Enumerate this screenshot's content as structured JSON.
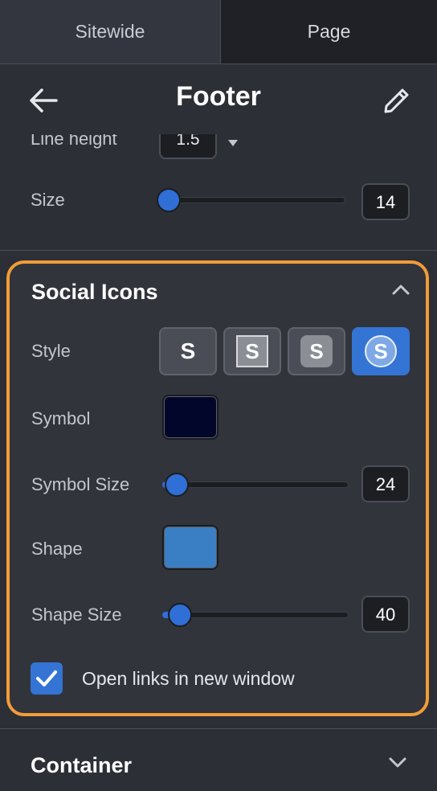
{
  "tabs": [
    {
      "label": "Sitewide"
    },
    {
      "label": "Page"
    }
  ],
  "header": {
    "title": "Footer"
  },
  "typography": {
    "line_height_label": "Line height",
    "line_height_value": "1.5",
    "size_label": "Size",
    "size_value": "14"
  },
  "social": {
    "title": "Social Icons",
    "style_label": "Style",
    "style_options": [
      {
        "glyph": "S",
        "kind": "plain"
      },
      {
        "glyph": "S",
        "kind": "square"
      },
      {
        "glyph": "S",
        "kind": "rounded"
      },
      {
        "glyph": "S",
        "kind": "circle",
        "selected": true
      }
    ],
    "symbol_label": "Symbol",
    "symbol_color": "#03062b",
    "symbol_size_label": "Symbol Size",
    "symbol_size_value": "24",
    "shape_label": "Shape",
    "shape_color": "#3a7ec4",
    "shape_size_label": "Shape Size",
    "shape_size_value": "40",
    "open_new_window_label": "Open links in new window",
    "open_new_window_checked": true
  },
  "container": {
    "title": "Container"
  },
  "colors": {
    "accent": "#2f6fd6",
    "highlight_border": "#f29c38"
  },
  "icons": {
    "back": "arrow-left-icon",
    "edit": "pencil-icon",
    "collapse": "chevron-up-icon",
    "expand": "chevron-down-icon",
    "check": "check-icon"
  }
}
